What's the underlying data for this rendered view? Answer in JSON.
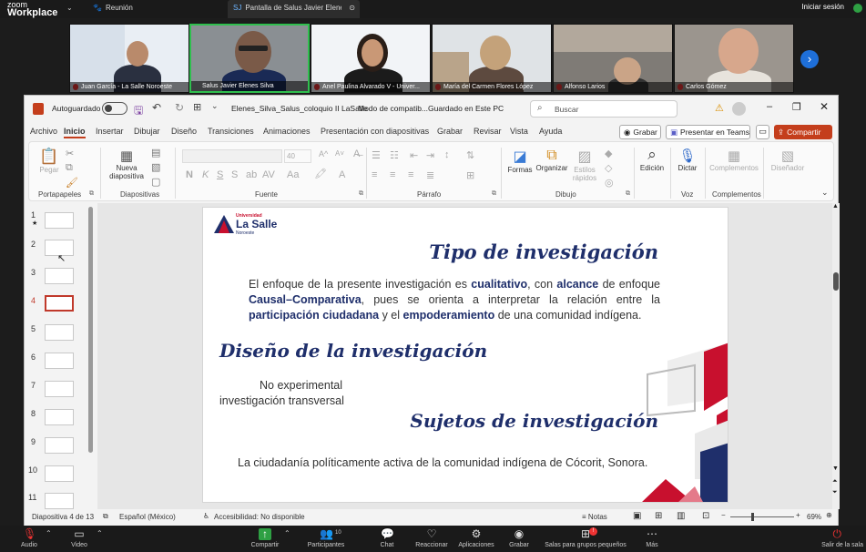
{
  "zoom": {
    "logo_top": "zoom",
    "logo_bottom": "Workplace",
    "tab_meeting": "Reunión",
    "tab_share_badge": "SJ",
    "tab_share": "Pantalla de Salus Javier Elenes Silva",
    "signin": "Iniciar sesión"
  },
  "participants": [
    {
      "name": "Juan García - La Salle Noroeste"
    },
    {
      "name": "Salus Javier Elenes Silva"
    },
    {
      "name": "Anel Paulina Alvarado V - Univer..."
    },
    {
      "name": "María del Carmen Flores López"
    },
    {
      "name": "Alfonso Larios"
    },
    {
      "name": "Carlos Gómez"
    }
  ],
  "ppt": {
    "autosave": "Autoguardado",
    "filename": "Elenes_Silva_Salus_coloquio II LaSalle",
    "mode": "Modo de compatib...",
    "saved": "Guardado en Este PC",
    "search_placeholder": "Buscar",
    "tabs": [
      "Archivo",
      "Inicio",
      "Insertar",
      "Dibujar",
      "Diseño",
      "Transiciones",
      "Animaciones",
      "Presentación con diapositivas",
      "Grabar",
      "Revisar",
      "Vista",
      "Ayuda"
    ],
    "btn_record": "Grabar",
    "btn_teams": "Presentar en Teams",
    "btn_share": "Compartir",
    "groups": {
      "clipboard": "Portapapeles",
      "paste": "Pegar",
      "slides": "Diapositivas",
      "new_slide": "Nueva diapositiva",
      "font": "Fuente",
      "font_size": "40",
      "paragraph": "Párrafo",
      "drawing": "Dibujo",
      "shapes": "Formas",
      "arrange": "Organizar",
      "quick_styles": "Estilos rápidos",
      "editing": "Edición",
      "voice": "Voz",
      "dictate": "Dictar",
      "addins": "Complementos",
      "addins_btn": "Complementos",
      "designer": "Diseñador"
    },
    "thumb_numbers": [
      "1",
      "2",
      "3",
      "4",
      "5",
      "6",
      "7",
      "8",
      "9",
      "10",
      "11"
    ],
    "status": {
      "slide": "Diapositiva 4 de 13",
      "lang": "Español (México)",
      "access": "Accesibilidad: No disponible",
      "notes": "Notas",
      "zoom": "69%"
    }
  },
  "slide": {
    "logo_univ": "Universidad",
    "logo_name": "La Salle",
    "logo_campus": "Noroeste",
    "title1": "Tipo de investigación",
    "p1_a": "El enfoque de la presente investigación es ",
    "p1_b": "cualitativo",
    "p1_c": ", con ",
    "p1_d": "alcance",
    "p1_e": " de enfoque ",
    "p1_f": "Causal–Comparativa",
    "p1_g": ", pues se orienta a interpretar la relación entre la ",
    "p1_h": "participación ciudadana",
    "p1_i": " y el ",
    "p1_j": "empoderamiento",
    "p1_k": " de una comunidad indígena.",
    "title2": "Diseño de la investigación",
    "design_1": "No experimental",
    "design_2": "investigación transversal",
    "title3": "Sujetos de investigación",
    "subjects": "La ciudadanía políticamente activa de la comunidad indígena de Cócorit, Sonora."
  },
  "bottom": {
    "audio": "Audio",
    "video": "Video",
    "share": "Compartir",
    "participants": "Participantes",
    "participants_count": "10",
    "chat": "Chat",
    "react": "Reaccionar",
    "apps": "Aplicaciones",
    "record": "Grabar",
    "breakout": "Salas para grupos pequeños",
    "more": "Más",
    "leave": "Salir de la sala"
  }
}
